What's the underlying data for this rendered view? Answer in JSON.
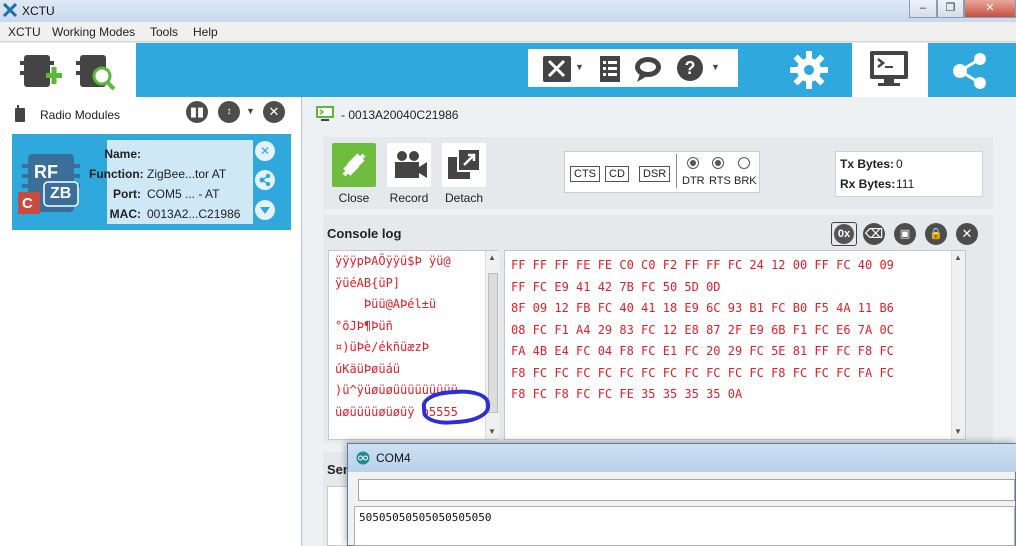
{
  "window": {
    "title": "XCTU",
    "controls": [
      "–",
      "❐",
      "✕"
    ]
  },
  "menu": [
    "XCTU",
    "Working Modes",
    "Tools",
    "Help"
  ],
  "left_panel": {
    "header": "Radio Modules",
    "device": {
      "labels": {
        "name": "Name:",
        "function": "Function:",
        "port": "Port:",
        "mac": "MAC:"
      },
      "values": {
        "name": "",
        "function": "ZigBee...tor AT",
        "port": "COM5 ... - AT",
        "mac": "0013A2...C21986"
      },
      "icon_text": {
        "rf": "RF",
        "zb": "ZB",
        "c": "C"
      }
    }
  },
  "console": {
    "address": "- 0013A20040C21986",
    "buttons": {
      "close": "Close",
      "record": "Record",
      "detach": "Detach"
    },
    "flags": [
      "CTS",
      "CD",
      "DSR"
    ],
    "lines": [
      {
        "label": "DTR",
        "on": true
      },
      {
        "label": "RTS",
        "on": true
      },
      {
        "label": "BRK",
        "on": false
      }
    ],
    "counters": {
      "tx_label": "Tx Bytes:",
      "tx_value": "0",
      "rx_label": "Rx Bytes:",
      "rx_value": "111"
    },
    "log_title": "Console log",
    "log_tools": {
      "hex": "0x"
    },
    "ascii": [
      "ÿÿÿpÞAÕÿÿü$Þ ÿü@",
      "ÿüéAB{üP]",
      "    Þüü@AÞél±ü",
      "°õJÞ¶Þüñ",
      "¤)üÞè/ékñüæzÞ",
      "úKäüÞøüáü",
      ")ü^ÿüøüøüüüüüüüüü",
      "üøüüüüøüøüÿ b5555"
    ],
    "hex": [
      "FF FF FF FE FE C0 C0 F2 FF FF FC 24 12 00 FF FC 40 09",
      "FF FC E9 41 42 7B FC 50 5D 0D",
      "8F 09 12 FB FC 40 41 18 E9 6C 93 B1 FC B0 F5 4A 11 B6",
      "08 FC F1 A4 29 83 FC 12 E8 87 2F E9 6B F1 FC E6 7A 0C",
      "FA 4B E4 FC 04 F8 FC E1 FC 20 29 FC 5E 81 FF FC F8 FC",
      "F8 FC FC FC FC FC FC FC FC FC FC FC F8 FC FC FC FA FC",
      "F8 FC F8 FC FC FE 35 35 35 35 0A"
    ],
    "send_label": "Sen"
  },
  "com_window": {
    "title": "COM4",
    "input_value": "",
    "output": "50505050505050505050"
  },
  "colors": {
    "accent": "#2fa8de",
    "log_text": "#e0202a",
    "circle": "#2b2fd4"
  }
}
